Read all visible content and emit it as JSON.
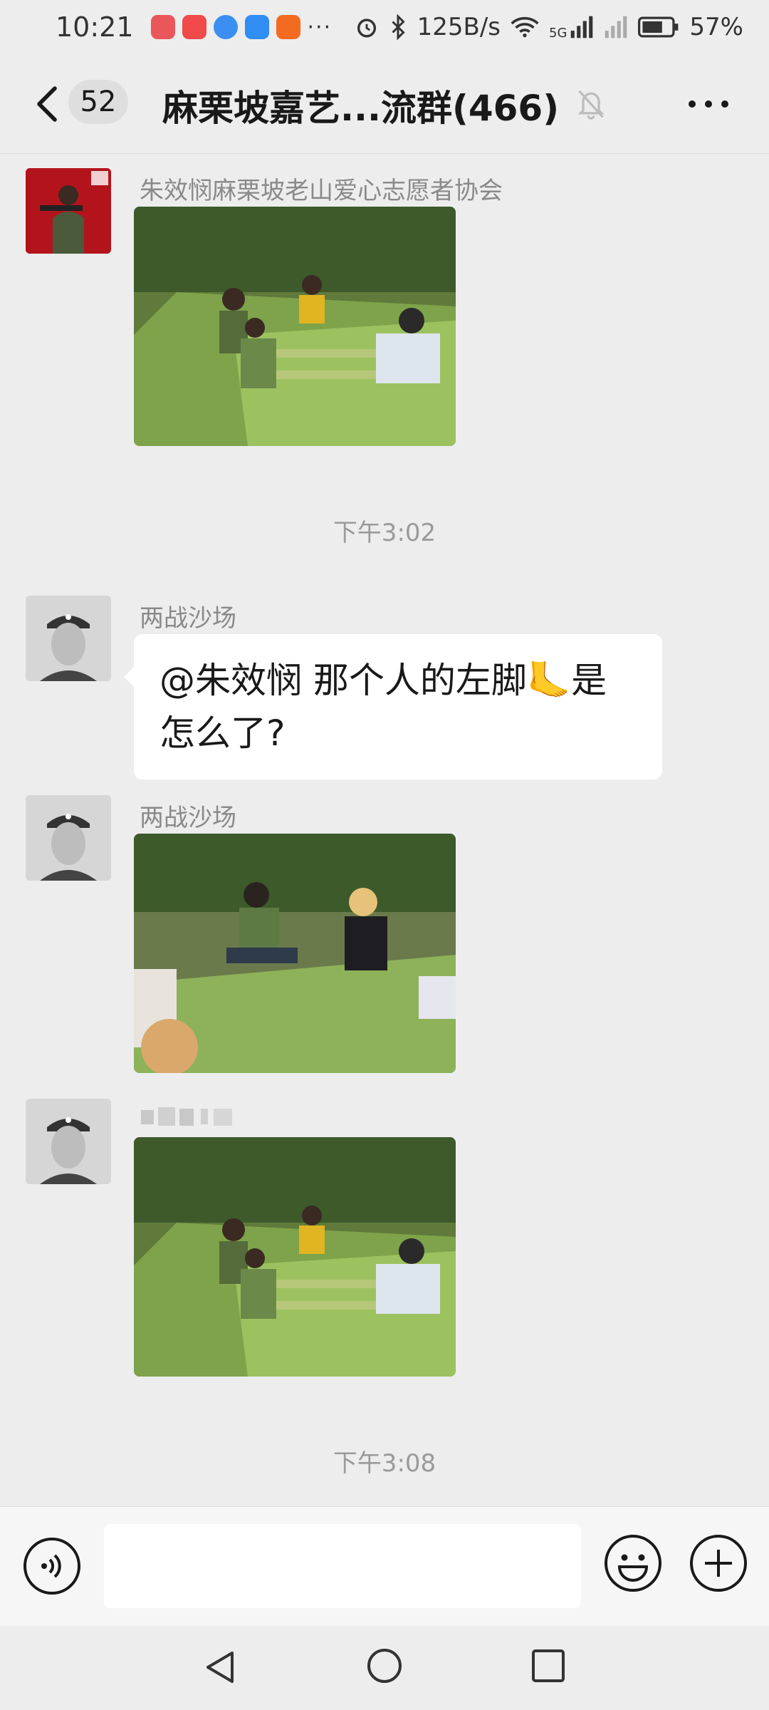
{
  "status_bar": {
    "time": "10:21",
    "more": "···",
    "network_speed": "125B/s",
    "signal_5g": "5G",
    "battery": "57%"
  },
  "header": {
    "unread_count": "52",
    "title": "麻栗坡嘉艺...流群(466)"
  },
  "messages": [
    {
      "sender": "朱效悯麻栗坡老山爱心志愿者协会",
      "type": "image"
    },
    {
      "type": "time",
      "text": "下午3:02"
    },
    {
      "sender": "两战沙场",
      "type": "text",
      "text": "@朱效悯 那个人的左脚🦶是怎么了?"
    },
    {
      "sender": "两战沙场",
      "type": "image"
    },
    {
      "sender": "",
      "type": "image"
    },
    {
      "type": "time",
      "text": "下午3:08"
    }
  ],
  "input": {
    "value": "",
    "placeholder": ""
  },
  "colors": {
    "background": "#ededed",
    "bubble": "#ffffff",
    "muted_text": "#8a8a8a"
  }
}
